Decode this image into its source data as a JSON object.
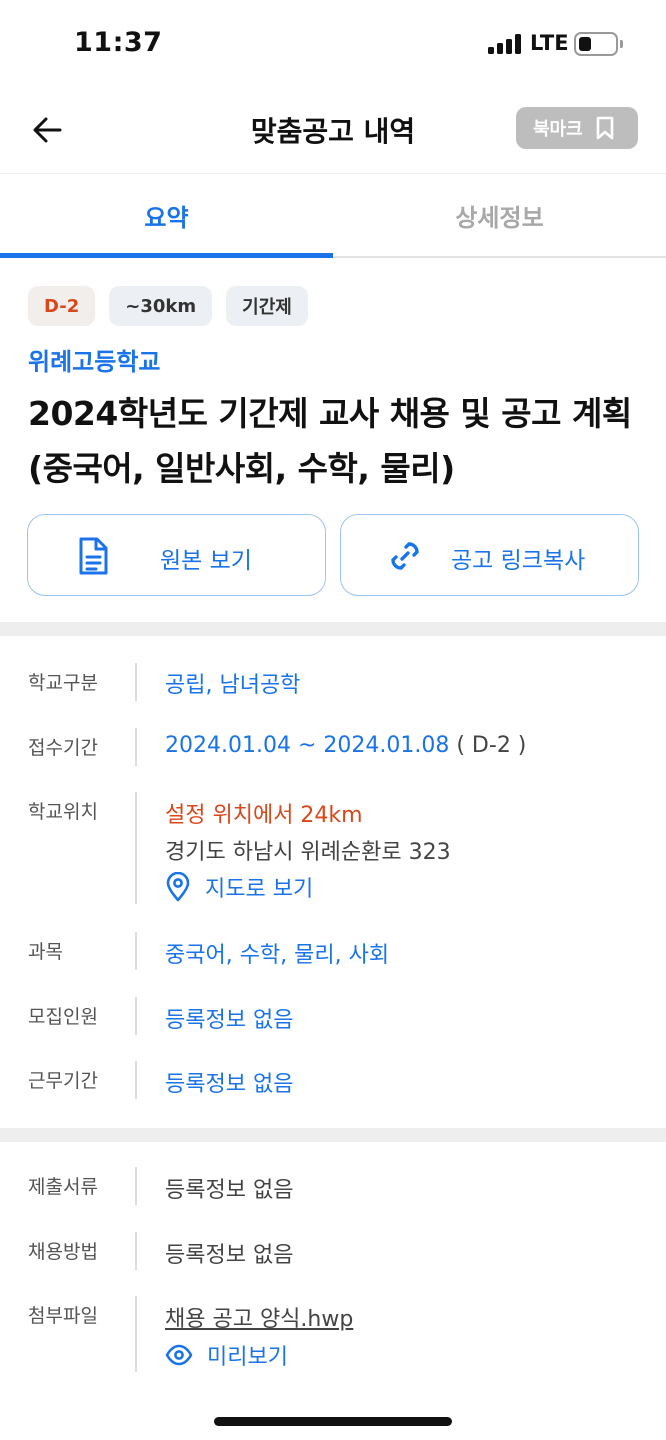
{
  "status_bar": {
    "time": "11:37",
    "network": "LTE"
  },
  "header": {
    "title": "맞춤공고 내역",
    "bookmark_label": "북마크"
  },
  "tabs": [
    {
      "label": "요약",
      "active": true
    },
    {
      "label": "상세정보",
      "active": false
    }
  ],
  "badges": [
    "D-2",
    "~30km",
    "기간제"
  ],
  "school_name": "위례고등학교",
  "job_title": "2024학년도 기간제 교사 채용 및 공고 계획(중국어, 일반사회, 수학, 물리)",
  "actions": {
    "original": "원본 보기",
    "copy_link": "공고 링크복사"
  },
  "info": {
    "school_type": {
      "label": "학교구분",
      "value": "공립, 남녀공학"
    },
    "period": {
      "label": "접수기간",
      "value": "2024.01.04 ~ 2024.01.08",
      "dday": "( D-2 )"
    },
    "location": {
      "label": "학교위치",
      "distance": "설정 위치에서 24km",
      "address": "경기도 하남시 위례순환로 323",
      "map_link": "지도로 보기"
    },
    "subjects": {
      "label": "과목",
      "value": "중국어, 수학, 물리, 사회"
    },
    "recruit_count": {
      "label": "모집인원",
      "value": "등록정보 없음"
    },
    "work_period": {
      "label": "근무기간",
      "value": "등록정보 없음"
    }
  },
  "extra": {
    "documents": {
      "label": "제출서류",
      "value": "등록정보 없음"
    },
    "method": {
      "label": "채용방법",
      "value": "등록정보 없음"
    },
    "attachment": {
      "label": "첨부파일",
      "file_name": "채용 공고 양식.hwp",
      "preview": "미리보기"
    }
  },
  "colors": {
    "accent": "#1a73e8",
    "warning": "#d9481a",
    "muted": "#bdbdbd"
  }
}
